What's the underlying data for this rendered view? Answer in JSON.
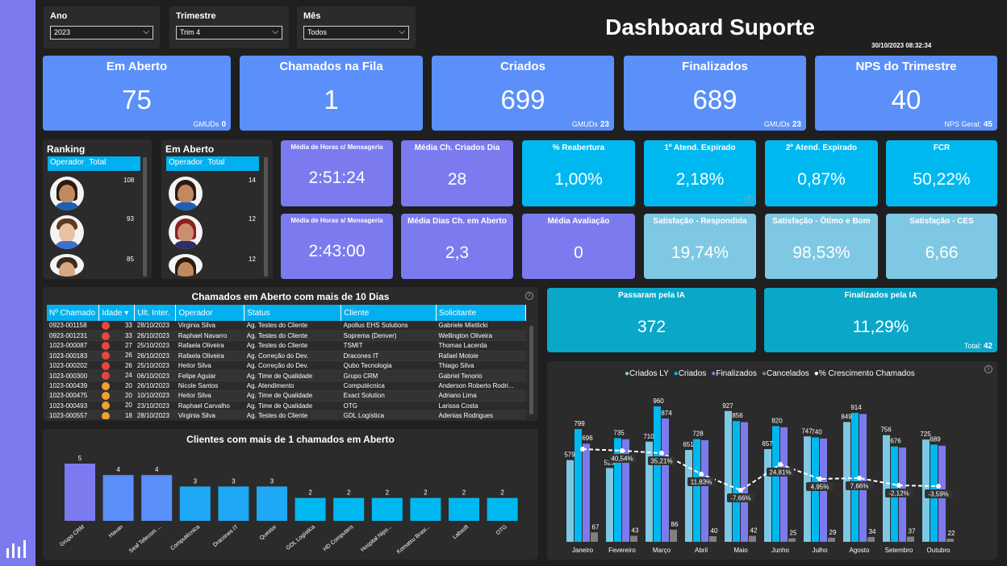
{
  "filters": [
    {
      "label": "Ano",
      "value": "2023"
    },
    {
      "label": "Trimestre",
      "value": "Trim 4"
    },
    {
      "label": "Mês",
      "value": "Todos"
    }
  ],
  "header": {
    "title": "Dashboard Suporte",
    "timestamp": "30/10/2023 08:32:34"
  },
  "kpis": [
    {
      "title": "Em Aberto",
      "value": "75",
      "sub_label": "GMUDs",
      "sub_value": "0"
    },
    {
      "title": "Chamados na Fila",
      "value": "1",
      "sub_label": "",
      "sub_value": ""
    },
    {
      "title": "Criados",
      "value": "699",
      "sub_label": "GMUDs",
      "sub_value": "23"
    },
    {
      "title": "Finalizados",
      "value": "689",
      "sub_label": "GMUDs",
      "sub_value": "23"
    },
    {
      "title": "NPS do Trimestre",
      "value": "40",
      "sub_label": "NPS Geral:",
      "sub_value": "45"
    }
  ],
  "ranking": {
    "title": "Ranking",
    "col1": "Operador",
    "col2": "Total",
    "values": [
      "108",
      "93",
      "85"
    ]
  },
  "open_rank": {
    "title": "Em Aberto",
    "col1": "Operador",
    "col2": "Total",
    "values": [
      "14",
      "12",
      "12"
    ]
  },
  "cards": [
    {
      "title": "Média de Horas c/ Mensageria",
      "value": "2:51:24"
    },
    {
      "title": "Média Ch. Criados Dia",
      "value": "28"
    },
    {
      "title": "% Reabertura",
      "value": "1,00%"
    },
    {
      "title": "1º Atend. Expirado",
      "value": "2,18%"
    },
    {
      "title": "2º Atend. Expirado",
      "value": "0,87%"
    },
    {
      "title": "FCR",
      "value": "50,22%"
    },
    {
      "title": "Média de Horas s/ Mensageria",
      "value": "2:43:00"
    },
    {
      "title": "Média Dias Ch. em Aberto",
      "value": "2,3"
    },
    {
      "title": "Média Avaliação",
      "value": "0"
    },
    {
      "title": "Satisfação - Respondida",
      "value": "19,74%"
    },
    {
      "title": "Satisfação - Ótimo e Bom",
      "value": "98,53%"
    },
    {
      "title": "Satisfação - CES",
      "value": "6,66"
    }
  ],
  "ia": {
    "passed_title": "Passaram pela IA",
    "passed_value": "372",
    "finished_title": "Finalizados pela IA",
    "finished_value": "11,29%",
    "total_label": "Total:",
    "total_value": "42"
  },
  "open_table": {
    "title": "Chamados em Aberto com mais de 10 Dias",
    "headers": [
      "Nº Chamado",
      "Idade",
      "Ult. Inter.",
      "Operador",
      "Status",
      "Cliente",
      "Solicitante"
    ],
    "rows": [
      [
        "0923-001158",
        "red",
        "33",
        "28/10/2023",
        "Virginia Silva",
        "Ag. Testes do Cliente",
        "Apollus EHS Solutions",
        "Gabriele Mietlicki"
      ],
      [
        "0923-001231",
        "red",
        "33",
        "26/10/2023",
        "Raphael Navarro",
        "Ag. Testes do Cliente",
        "Soprema (Denver)",
        "Wellington Oliveira"
      ],
      [
        "1023-000087",
        "red",
        "27",
        "25/10/2023",
        "Rafaela Oliveira",
        "Ag. Testes do Cliente",
        "TSMIT",
        "Thomas Lacerda"
      ],
      [
        "1023-000183",
        "red",
        "26",
        "26/10/2023",
        "Rafaela Oliveira",
        "Ag. Correção do Dev.",
        "Dracones IT",
        "Rafael Motoie"
      ],
      [
        "1023-000202",
        "red",
        "26",
        "25/10/2023",
        "Heitor Silva",
        "Ag. Correção do Dev.",
        "Qubo Tecnologia",
        "Thiago Silva"
      ],
      [
        "1023-000300",
        "red",
        "24",
        "06/10/2023",
        "Felipe Aguiar",
        "Ag. Time de Qualidade",
        "Grupo CRM",
        "Gabriel Tenorio"
      ],
      [
        "1023-000439",
        "orange",
        "20",
        "26/10/2023",
        "Nicole Santos",
        "Ag. Atendimento",
        "Computécnica",
        "Anderson Roberto Rodri..."
      ],
      [
        "1023-000475",
        "orange",
        "20",
        "10/10/2023",
        "Heitor Silva",
        "Ag. Time de Qualidade",
        "Exact Solution",
        "Adriano Lima"
      ],
      [
        "1023-000493",
        "orange",
        "20",
        "23/10/2023",
        "Raphael Carvalho",
        "Ag. Time de Qualidade",
        "OTG",
        "Larissa Costa"
      ],
      [
        "1023-000557",
        "orange",
        "18",
        "28/10/2023",
        "Virginia Silva",
        "Ag. Testes do Cliente",
        "GDL Logística",
        "Adenias Rodrigues"
      ]
    ]
  },
  "clients_chart": {
    "title": "Clientes com mais de 1 chamados em Aberto",
    "chart_data": {
      "type": "bar",
      "categories": [
        "Grupo CRM",
        "Havan",
        "Seal Telecom ...",
        "Computécnica",
        "Dracones IT",
        "Questor",
        "GDL Logística",
        "HD Computers",
        "Hospital Nipo...",
        "Komatsu Brasi...",
        "Labsoft",
        "OTG"
      ],
      "values": [
        5,
        4,
        4,
        3,
        3,
        3,
        2,
        2,
        2,
        2,
        2,
        2
      ],
      "colors": [
        "#7b7bef",
        "#5b8ff9",
        "#5b8ff9",
        "#1fa8f5",
        "#1fa8f5",
        "#1fa8f5",
        "#00b8f0",
        "#00b8f0",
        "#00b8f0",
        "#00b8f0",
        "#00b8f0",
        "#00b8f0"
      ]
    }
  },
  "monthly_chart": {
    "legend": [
      "Criados LY",
      "Criados",
      "Finalizados",
      "Cancelados",
      "% Crescimento Chamados"
    ],
    "legend_colors": [
      "#7ec8e3",
      "#00b8f0",
      "#7b7bef",
      "#808080",
      "#ffffff"
    ],
    "chart_data": {
      "type": "bar",
      "categories": [
        "Janeiro",
        "Fevereiro",
        "Março",
        "Abril",
        "Maio",
        "Junho",
        "Julho",
        "Agosto",
        "Setembro",
        "Outubro"
      ],
      "series": [
        {
          "name": "Criados LY",
          "values": [
            579,
            523,
            710,
            651,
            927,
            657,
            747,
            849,
            756,
            725
          ]
        },
        {
          "name": "Criados",
          "values": [
            799,
            735,
            960,
            728,
            856,
            820,
            740,
            914,
            676,
            689
          ]
        },
        {
          "name": "Finalizados",
          "values": [
            696,
            null,
            874,
            null,
            null,
            null,
            null,
            null,
            null,
            null
          ]
        },
        {
          "name": "Cancelados",
          "values": [
            67,
            43,
            86,
            40,
            42,
            25,
            29,
            34,
            37,
            22
          ]
        },
        {
          "name": "% Crescimento Chamados",
          "values": [
            null,
            "40,54%",
            "35,21%",
            "11,83%",
            "-7,66%",
            "24,81%",
            "4,95%",
            "7,66%",
            "-2,12%",
            "-3,59%"
          ]
        }
      ]
    }
  }
}
